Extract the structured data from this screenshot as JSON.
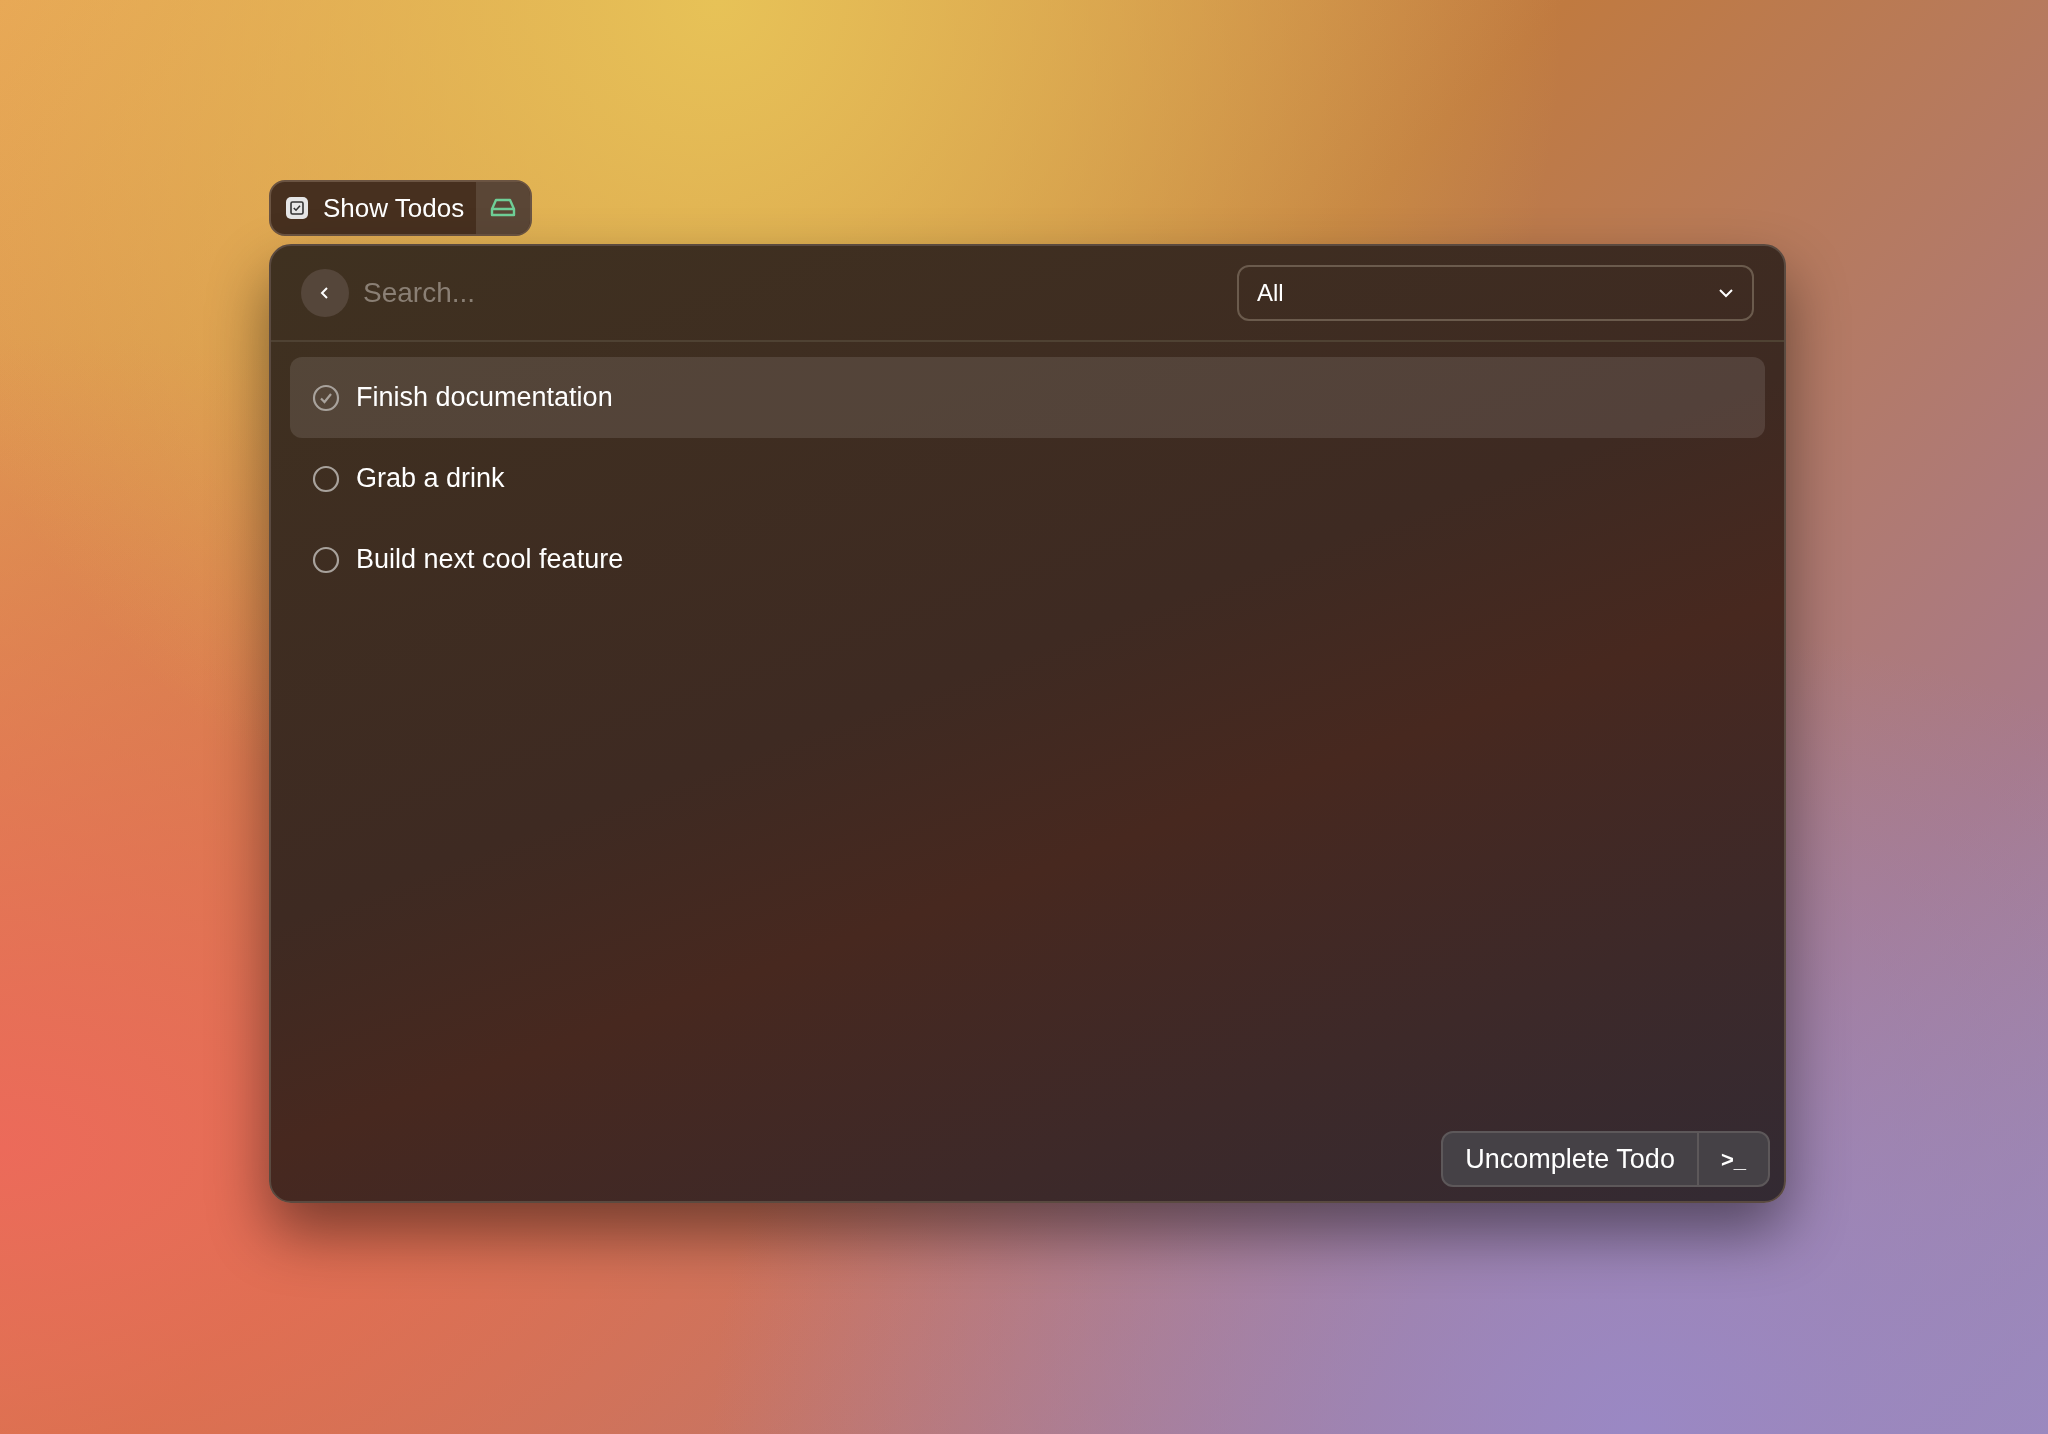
{
  "command": {
    "title": "Show Todos"
  },
  "search": {
    "placeholder": "Search..."
  },
  "filter": {
    "value": "All"
  },
  "todos": [
    {
      "title": "Finish documentation",
      "completed": true,
      "selected": true
    },
    {
      "title": "Grab a drink",
      "completed": false,
      "selected": false
    },
    {
      "title": "Build next cool feature",
      "completed": false,
      "selected": false
    }
  ],
  "action_bar": {
    "primary": "Uncomplete Todo",
    "secondary": ">_"
  }
}
